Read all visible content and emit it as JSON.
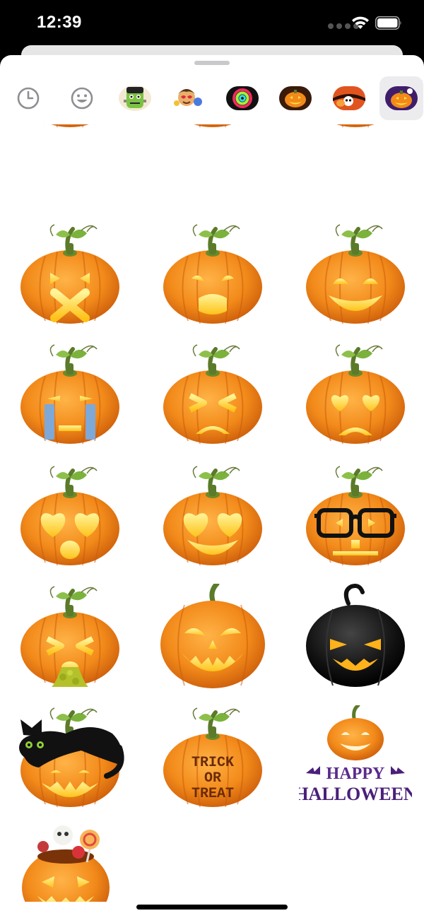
{
  "status_bar": {
    "time": "12:39"
  },
  "sticker_categories": [
    {
      "name": "recents",
      "icon": "clock-icon"
    },
    {
      "name": "emoji",
      "icon": "smiley-icon"
    },
    {
      "name": "frankenstein-pack",
      "icon": "frankenstein-icon"
    },
    {
      "name": "cartoon-faces-pack",
      "icon": "cartoon-faces-icon"
    },
    {
      "name": "activity-rings-pack",
      "icon": "activity-rings-icon"
    },
    {
      "name": "pumpkin-pack-1",
      "icon": "pumpkin-icon"
    },
    {
      "name": "skull-pumpkin-pack",
      "icon": "skull-pumpkin-icon"
    },
    {
      "name": "pumpkin-pack-2",
      "icon": "pumpkin-purple-icon",
      "selected": true
    }
  ],
  "stickers": [
    {
      "name": "x-face-pumpkin"
    },
    {
      "name": "yawn-face-pumpkin"
    },
    {
      "name": "grin-face-pumpkin"
    },
    {
      "name": "crying-pumpkin"
    },
    {
      "name": "squint-frown-pumpkin"
    },
    {
      "name": "heart-eyes-frown-pumpkin"
    },
    {
      "name": "heart-eyes-surprised-pumpkin"
    },
    {
      "name": "heart-eyes-grin-pumpkin"
    },
    {
      "name": "glasses-pumpkin"
    },
    {
      "name": "vomiting-pumpkin"
    },
    {
      "name": "classic-jack-o-lantern"
    },
    {
      "name": "black-pumpkin"
    },
    {
      "name": "black-cat-pumpkin"
    },
    {
      "name": "trick-or-treat-pumpkin",
      "text_lines": [
        "TRICK",
        "OR",
        "TREAT"
      ]
    },
    {
      "name": "happy-halloween-pumpkin",
      "text_lines": [
        "HAPPY",
        "HALLOWEEN"
      ]
    },
    {
      "name": "candy-bucket-pumpkin"
    }
  ],
  "colors": {
    "pumpkin": "#f28a1a",
    "pumpkin_dark": "#d2620c",
    "glow": "#ffe14a",
    "stem": "#6aa13a",
    "halloween_purple": "#5a2a8c"
  }
}
